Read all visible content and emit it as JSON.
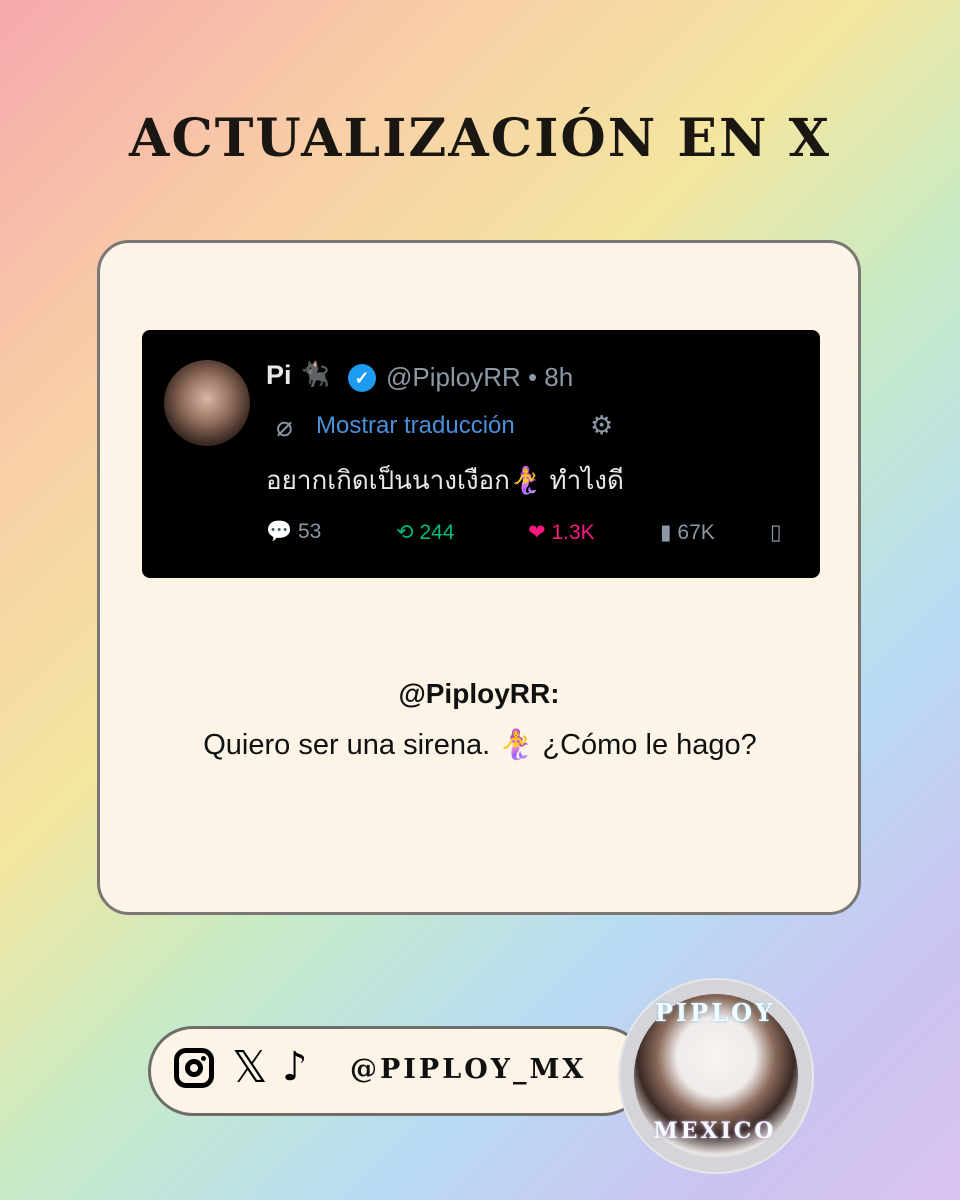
{
  "title": "ACTUALIZACIÓN EN X",
  "tweet": {
    "name": "Pi",
    "name_emoji": "🐈‍⬛",
    "handle": "@PiployRR • 8h",
    "translate_label": "Mostrar traducción",
    "text": "อยากเกิดเป็นนางเงือก🧜‍♀️ ทำไงดี",
    "replies": "53",
    "retweets": "244",
    "likes": "1.3K",
    "views": "67K"
  },
  "caption": {
    "user": "@PiployRR:",
    "text": "Quiero ser una sirena. 🧜‍♀️ ¿Cómo le hago?"
  },
  "social": {
    "handle": "@PIPLOY_MX"
  },
  "badge": {
    "top": "PIPLOY",
    "bottom": "MEXICO"
  }
}
